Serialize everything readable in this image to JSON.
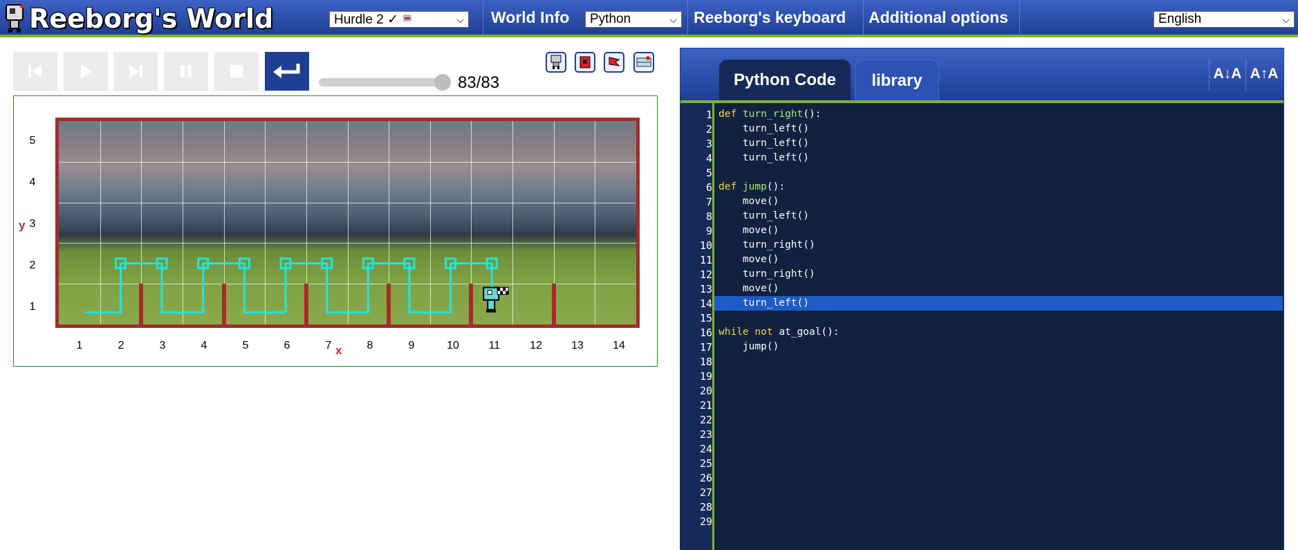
{
  "header": {
    "title": "Reeborg's World",
    "world_select": "Hurdle 2 ✓",
    "world_info": "World Info",
    "language_select": "Python",
    "keyboard": "Reeborg's keyboard",
    "options": "Additional options",
    "ui_language": "English"
  },
  "controls": {
    "step_counter": "83/83",
    "step_progress": 1.0,
    "buttons": [
      "reverse-step",
      "run",
      "step",
      "pause",
      "stop",
      "reload"
    ]
  },
  "world": {
    "x_label": "x",
    "y_label": "y",
    "x_ticks": [
      "1",
      "2",
      "3",
      "4",
      "5",
      "6",
      "7",
      "8",
      "9",
      "10",
      "11",
      "12",
      "13",
      "14"
    ],
    "y_ticks": [
      "5",
      "4",
      "3",
      "2",
      "1"
    ],
    "robot_position": [
      11,
      1
    ],
    "goal_position": [
      11,
      1
    ],
    "hurdle_walls_after_x": [
      2,
      4,
      6,
      8,
      10,
      12
    ]
  },
  "editor": {
    "tabs": [
      "Python Code",
      "library"
    ],
    "font_decrease": "A↓A",
    "font_increase": "A↑A",
    "highlighted_line": 14,
    "line_numbers": [
      "1",
      "2",
      "3",
      "4",
      "5",
      "6",
      "7",
      "8",
      "9",
      "10",
      "11",
      "12",
      "13",
      "14",
      "15",
      "16",
      "17",
      "18",
      "19",
      "20",
      "21",
      "22",
      "23",
      "24",
      "25",
      "26",
      "27",
      "28",
      "29"
    ],
    "lines": [
      "def turn_right():",
      "    turn_left()",
      "    turn_left()",
      "    turn_left()",
      "",
      "def jump():",
      "    move()",
      "    turn_left()",
      "    move()",
      "    turn_right()",
      "    move()",
      "    turn_right()",
      "    move()",
      "    turn_left()",
      "",
      "while not at_goal():",
      "    jump()"
    ]
  }
}
